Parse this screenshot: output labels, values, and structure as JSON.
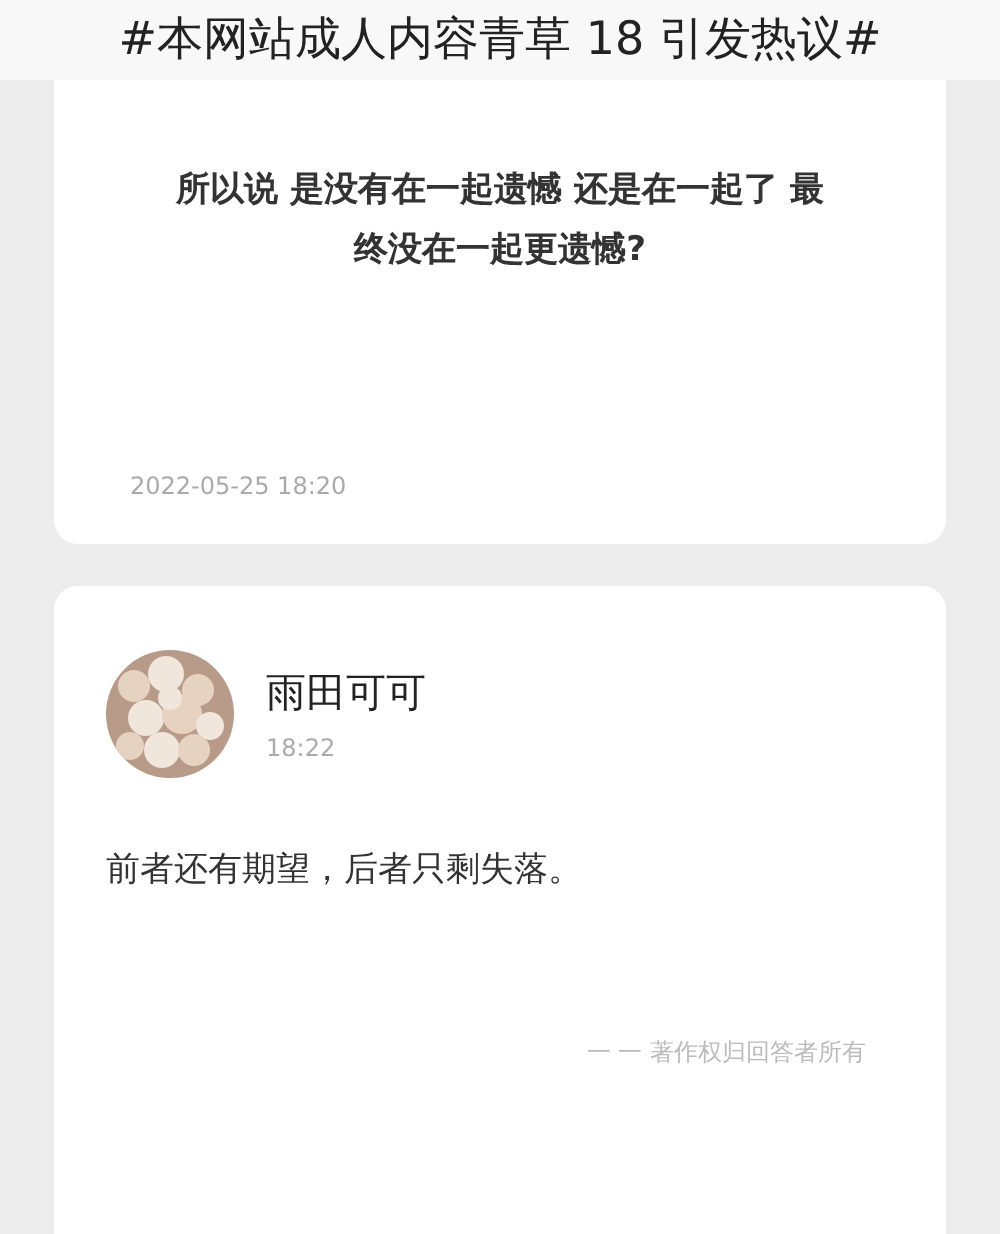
{
  "banner_title": "#本网站成人内容青草 18 引发热议#",
  "question_card": {
    "question": "所以说 是没有在一起遗憾 还是在一起了 最终没在一起更遗憾?",
    "date": "2022-05-25 18:20"
  },
  "answer_card": {
    "author": "雨田可可",
    "time": "18:22",
    "answer": "前者还有期望，后者只剩失落。",
    "copyright": "一 一 著作权归回答者所有"
  }
}
